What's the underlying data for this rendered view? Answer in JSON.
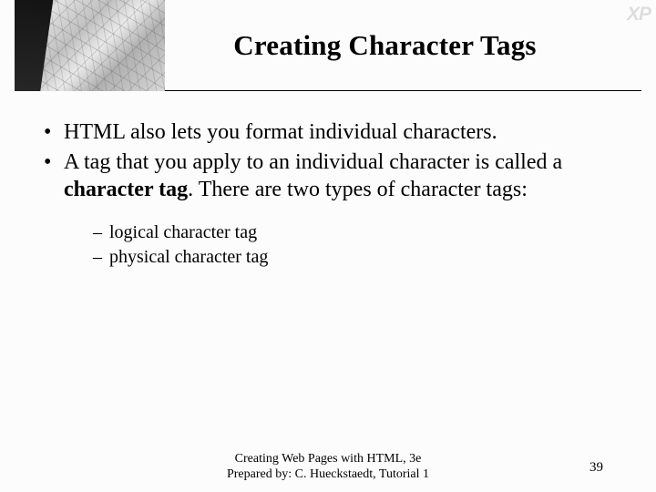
{
  "badge": "XP",
  "title": "Creating Character Tags",
  "bullets": {
    "b1": "HTML also lets you format individual characters.",
    "b2_pre": "A tag that you apply to an individual character is called a ",
    "b2_term": "character tag",
    "b2_post": ".  There are two types of character tags:"
  },
  "sub_bullets": {
    "s1": "logical character tag",
    "s2": "physical character tag"
  },
  "footer": {
    "line1": "Creating Web Pages with HTML, 3e",
    "line2": "Prepared by: C. Hueckstaedt, Tutorial 1"
  },
  "page_number": "39"
}
